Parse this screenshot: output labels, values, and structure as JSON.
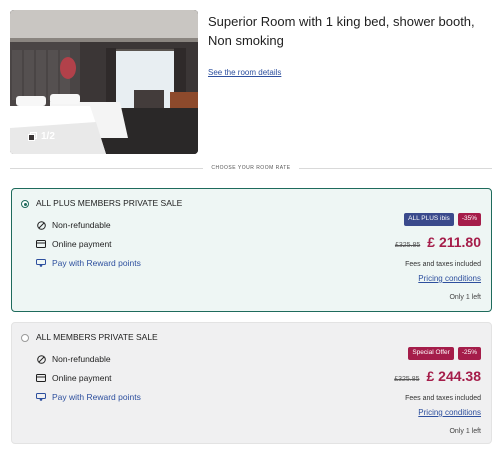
{
  "room": {
    "title": "Superior Room with 1 king bed, shower booth, Non smoking",
    "details_link": "See the room details",
    "photo_counter": "1/2"
  },
  "divider_label": "CHOOSE YOUR ROOM RATE",
  "rates": [
    {
      "name": "ALL PLUS MEMBERS PRIVATE SALE",
      "selected": true,
      "features": [
        "Non-refundable",
        "Online payment",
        "Pay with Reward points"
      ],
      "badges": [
        "ALL PLUS ibis",
        "-35%"
      ],
      "old_price": "£325.85",
      "price": "£ 211.80",
      "fees": "Fees and taxes included",
      "pricing_link": "Pricing conditions",
      "availability": "Only 1 left"
    },
    {
      "name": "ALL MEMBERS PRIVATE SALE",
      "selected": false,
      "features": [
        "Non-refundable",
        "Online payment",
        "Pay with Reward points"
      ],
      "badges": [
        "Special Offer",
        "-25%"
      ],
      "old_price": "£325.85",
      "price": "£ 244.38",
      "fees": "Fees and taxes included",
      "pricing_link": "Pricing conditions",
      "availability": "Only 1 left"
    }
  ],
  "colors": {
    "accent": "#1e6b5c",
    "price": "#a51d4a",
    "link": "#2d4f9e",
    "badge_member": "#3a4a8c"
  },
  "icons": {
    "gallery": "gallery-icon",
    "non_refundable": "no-entry-icon",
    "online_payment": "credit-card-icon",
    "reward": "reward-points-icon"
  }
}
